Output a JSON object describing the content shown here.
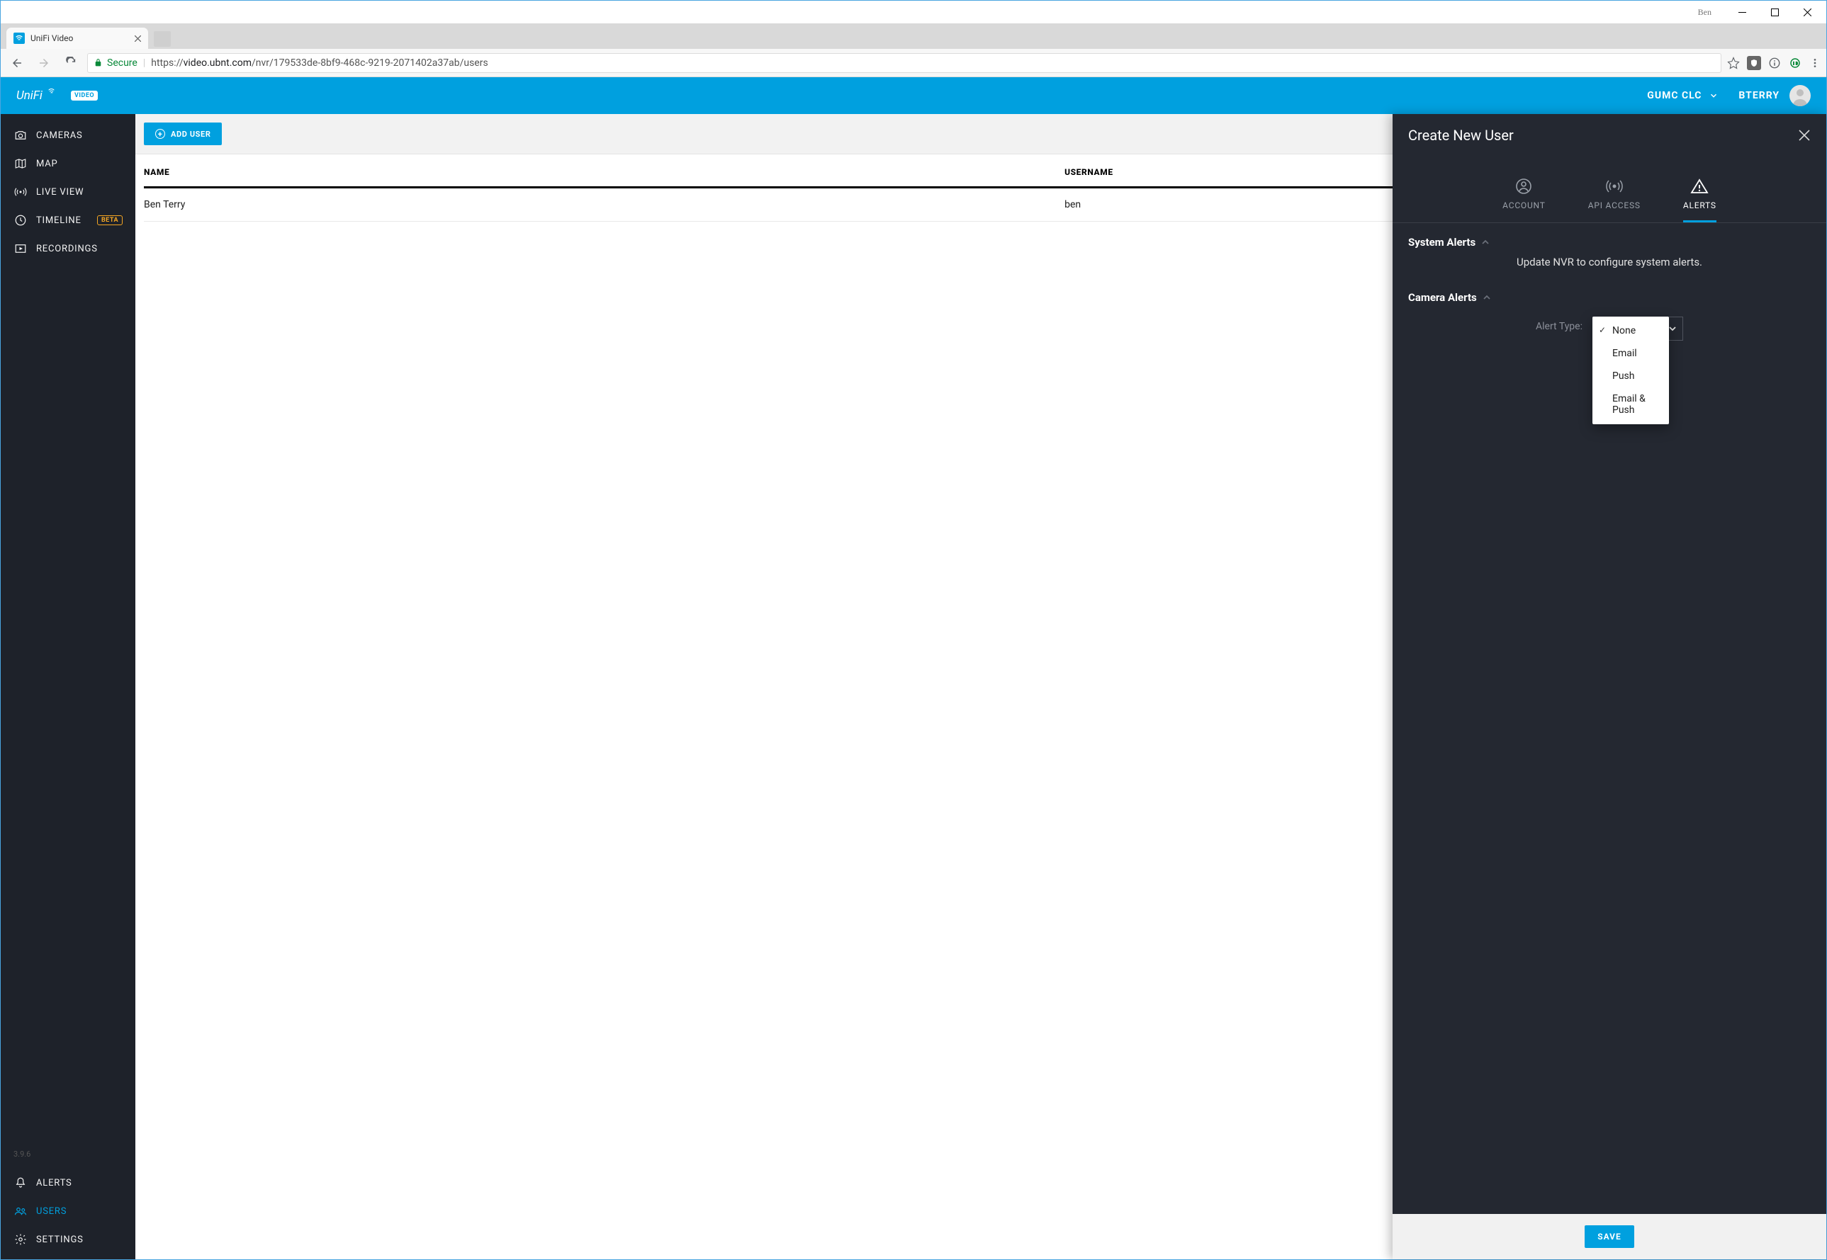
{
  "window": {
    "profile_name": "Ben"
  },
  "browser": {
    "tab_title": "UniFi Video",
    "secure_label": "Secure",
    "url_scheme": "https://",
    "url_host": "video.ubnt.com",
    "url_path": "/nvr/179533de-8bf9-468c-9219-2071402a37ab/users"
  },
  "header": {
    "logo_text": "UniFi",
    "logo_badge": "VIDEO",
    "org_label": "GUMC CLC",
    "user_label": "BTERRY"
  },
  "sidebar": {
    "items": [
      {
        "label": "CAMERAS"
      },
      {
        "label": "MAP"
      },
      {
        "label": "LIVE VIEW"
      },
      {
        "label": "TIMELINE",
        "badge": "BETA"
      },
      {
        "label": "RECORDINGS"
      }
    ],
    "bottom_items": [
      {
        "label": "ALERTS"
      },
      {
        "label": "USERS",
        "active": true
      },
      {
        "label": "SETTINGS"
      }
    ],
    "version": "3.9.6"
  },
  "toolbar": {
    "add_user_label": "ADD USER"
  },
  "table": {
    "columns": {
      "name": "NAME",
      "username": "USERNAME"
    },
    "rows": [
      {
        "name": "Ben Terry",
        "username": "ben"
      }
    ]
  },
  "drawer": {
    "title": "Create New User",
    "tabs": {
      "account": "ACCOUNT",
      "api": "API ACCESS",
      "alerts": "ALERTS"
    },
    "system_alerts": {
      "heading": "System Alerts",
      "message": "Update NVR to configure system alerts."
    },
    "camera_alerts": {
      "heading": "Camera Alerts",
      "alert_type_label": "Alert Type:",
      "selected": "None",
      "options": [
        "None",
        "Email",
        "Push",
        "Email & Push"
      ]
    },
    "save_label": "SAVE"
  }
}
